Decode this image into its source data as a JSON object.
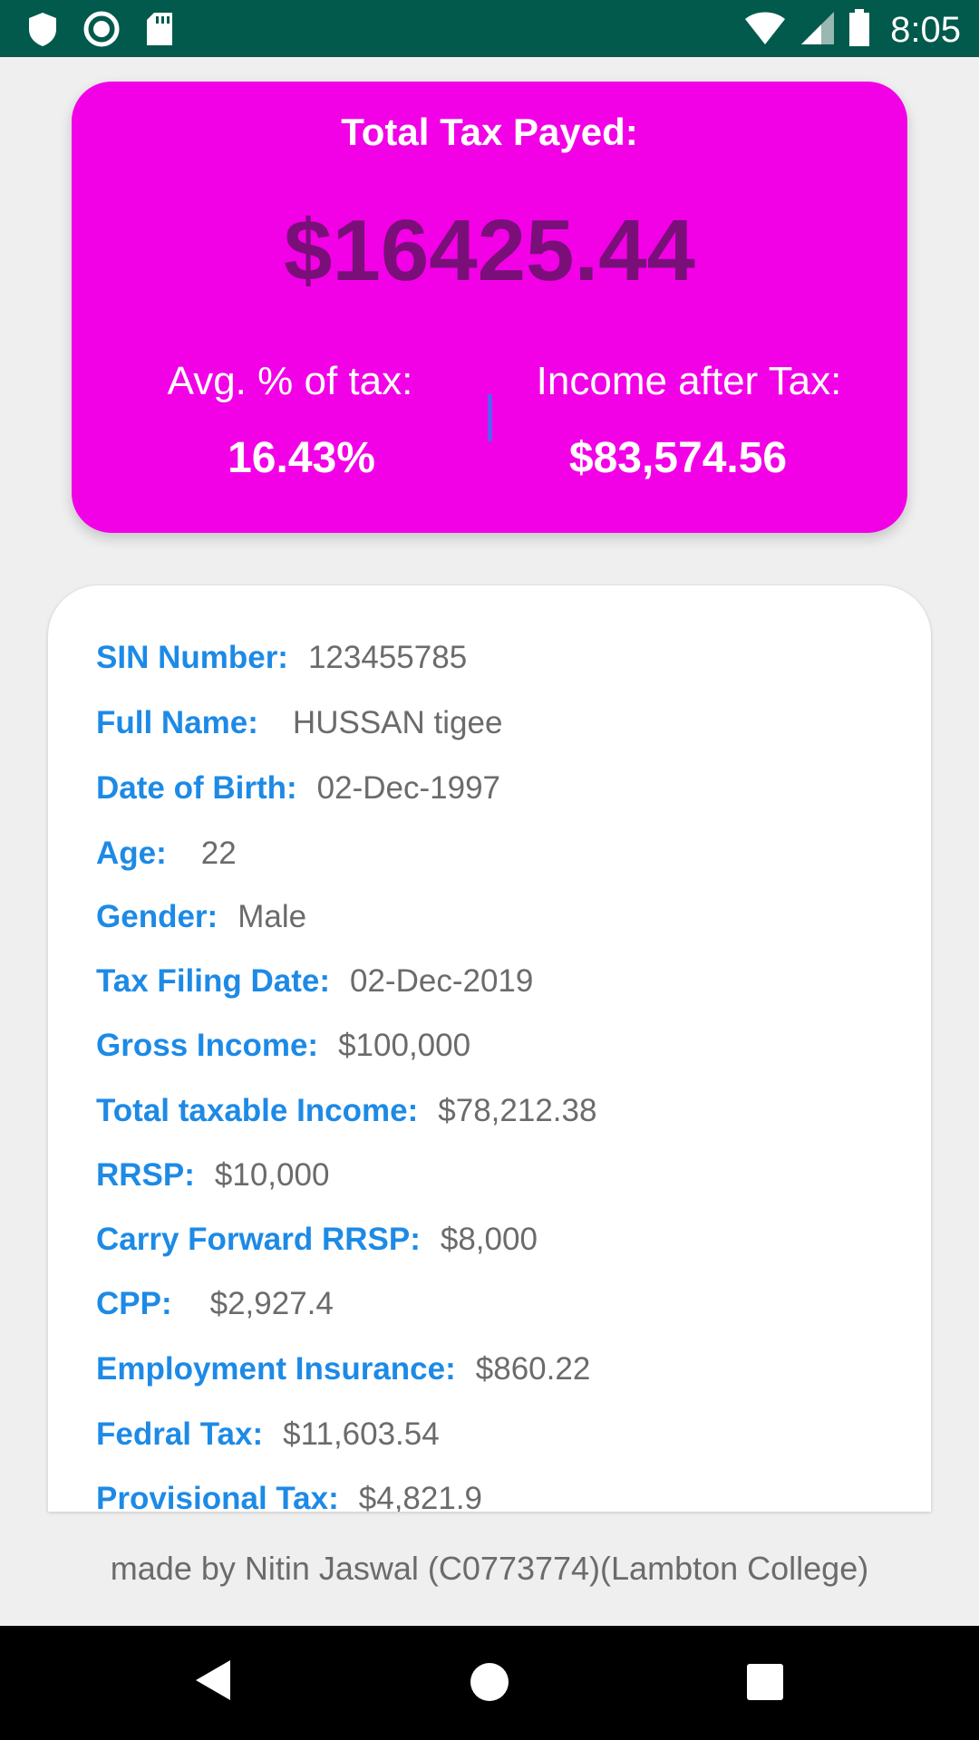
{
  "status_bar": {
    "time": "8:05",
    "icons_left": [
      "shield-icon",
      "record-icon",
      "sd-card-icon"
    ],
    "icons_right": [
      "wifi-icon",
      "signal-icon",
      "battery-icon"
    ]
  },
  "summary": {
    "title": "Total Tax Payed:",
    "total_tax": "$16425.44",
    "avg_label": "Avg. % of tax:",
    "avg_value": "16.43%",
    "after_label": "Income after Tax:",
    "after_value": "$83,574.56",
    "card_color": "#f200e6",
    "amount_color": "#7a0f7a"
  },
  "details": [
    {
      "label": "SIN Number:",
      "value": "123455785"
    },
    {
      "label": "Full Name:",
      "value": "HUSSAN tigee"
    },
    {
      "label": "Date of Birth:",
      "value": "02-Dec-1997"
    },
    {
      "label": "Age:",
      "value": "22"
    },
    {
      "label": "Gender:",
      "value": "Male"
    },
    {
      "label": "Tax Filing Date:",
      "value": "02-Dec-2019"
    },
    {
      "label": "Gross Income:",
      "value": "$100,000"
    },
    {
      "label": "Total taxable Income:",
      "value": "$78,212.38"
    },
    {
      "label": "RRSP:",
      "value": "$10,000"
    },
    {
      "label": "Carry Forward RRSP:",
      "value": "$8,000"
    },
    {
      "label": "CPP:",
      "value": "$2,927.4"
    },
    {
      "label": "Employment Insurance:",
      "value": "$860.22"
    },
    {
      "label": "Fedral Tax:",
      "value": "$11,603.54"
    },
    {
      "label": "Provisional Tax:",
      "value": "$4,821.9"
    }
  ],
  "footer": "made by Nitin Jaswal (C0773774)(Lambton College)",
  "nav": [
    "back-icon",
    "home-icon",
    "recents-icon"
  ]
}
